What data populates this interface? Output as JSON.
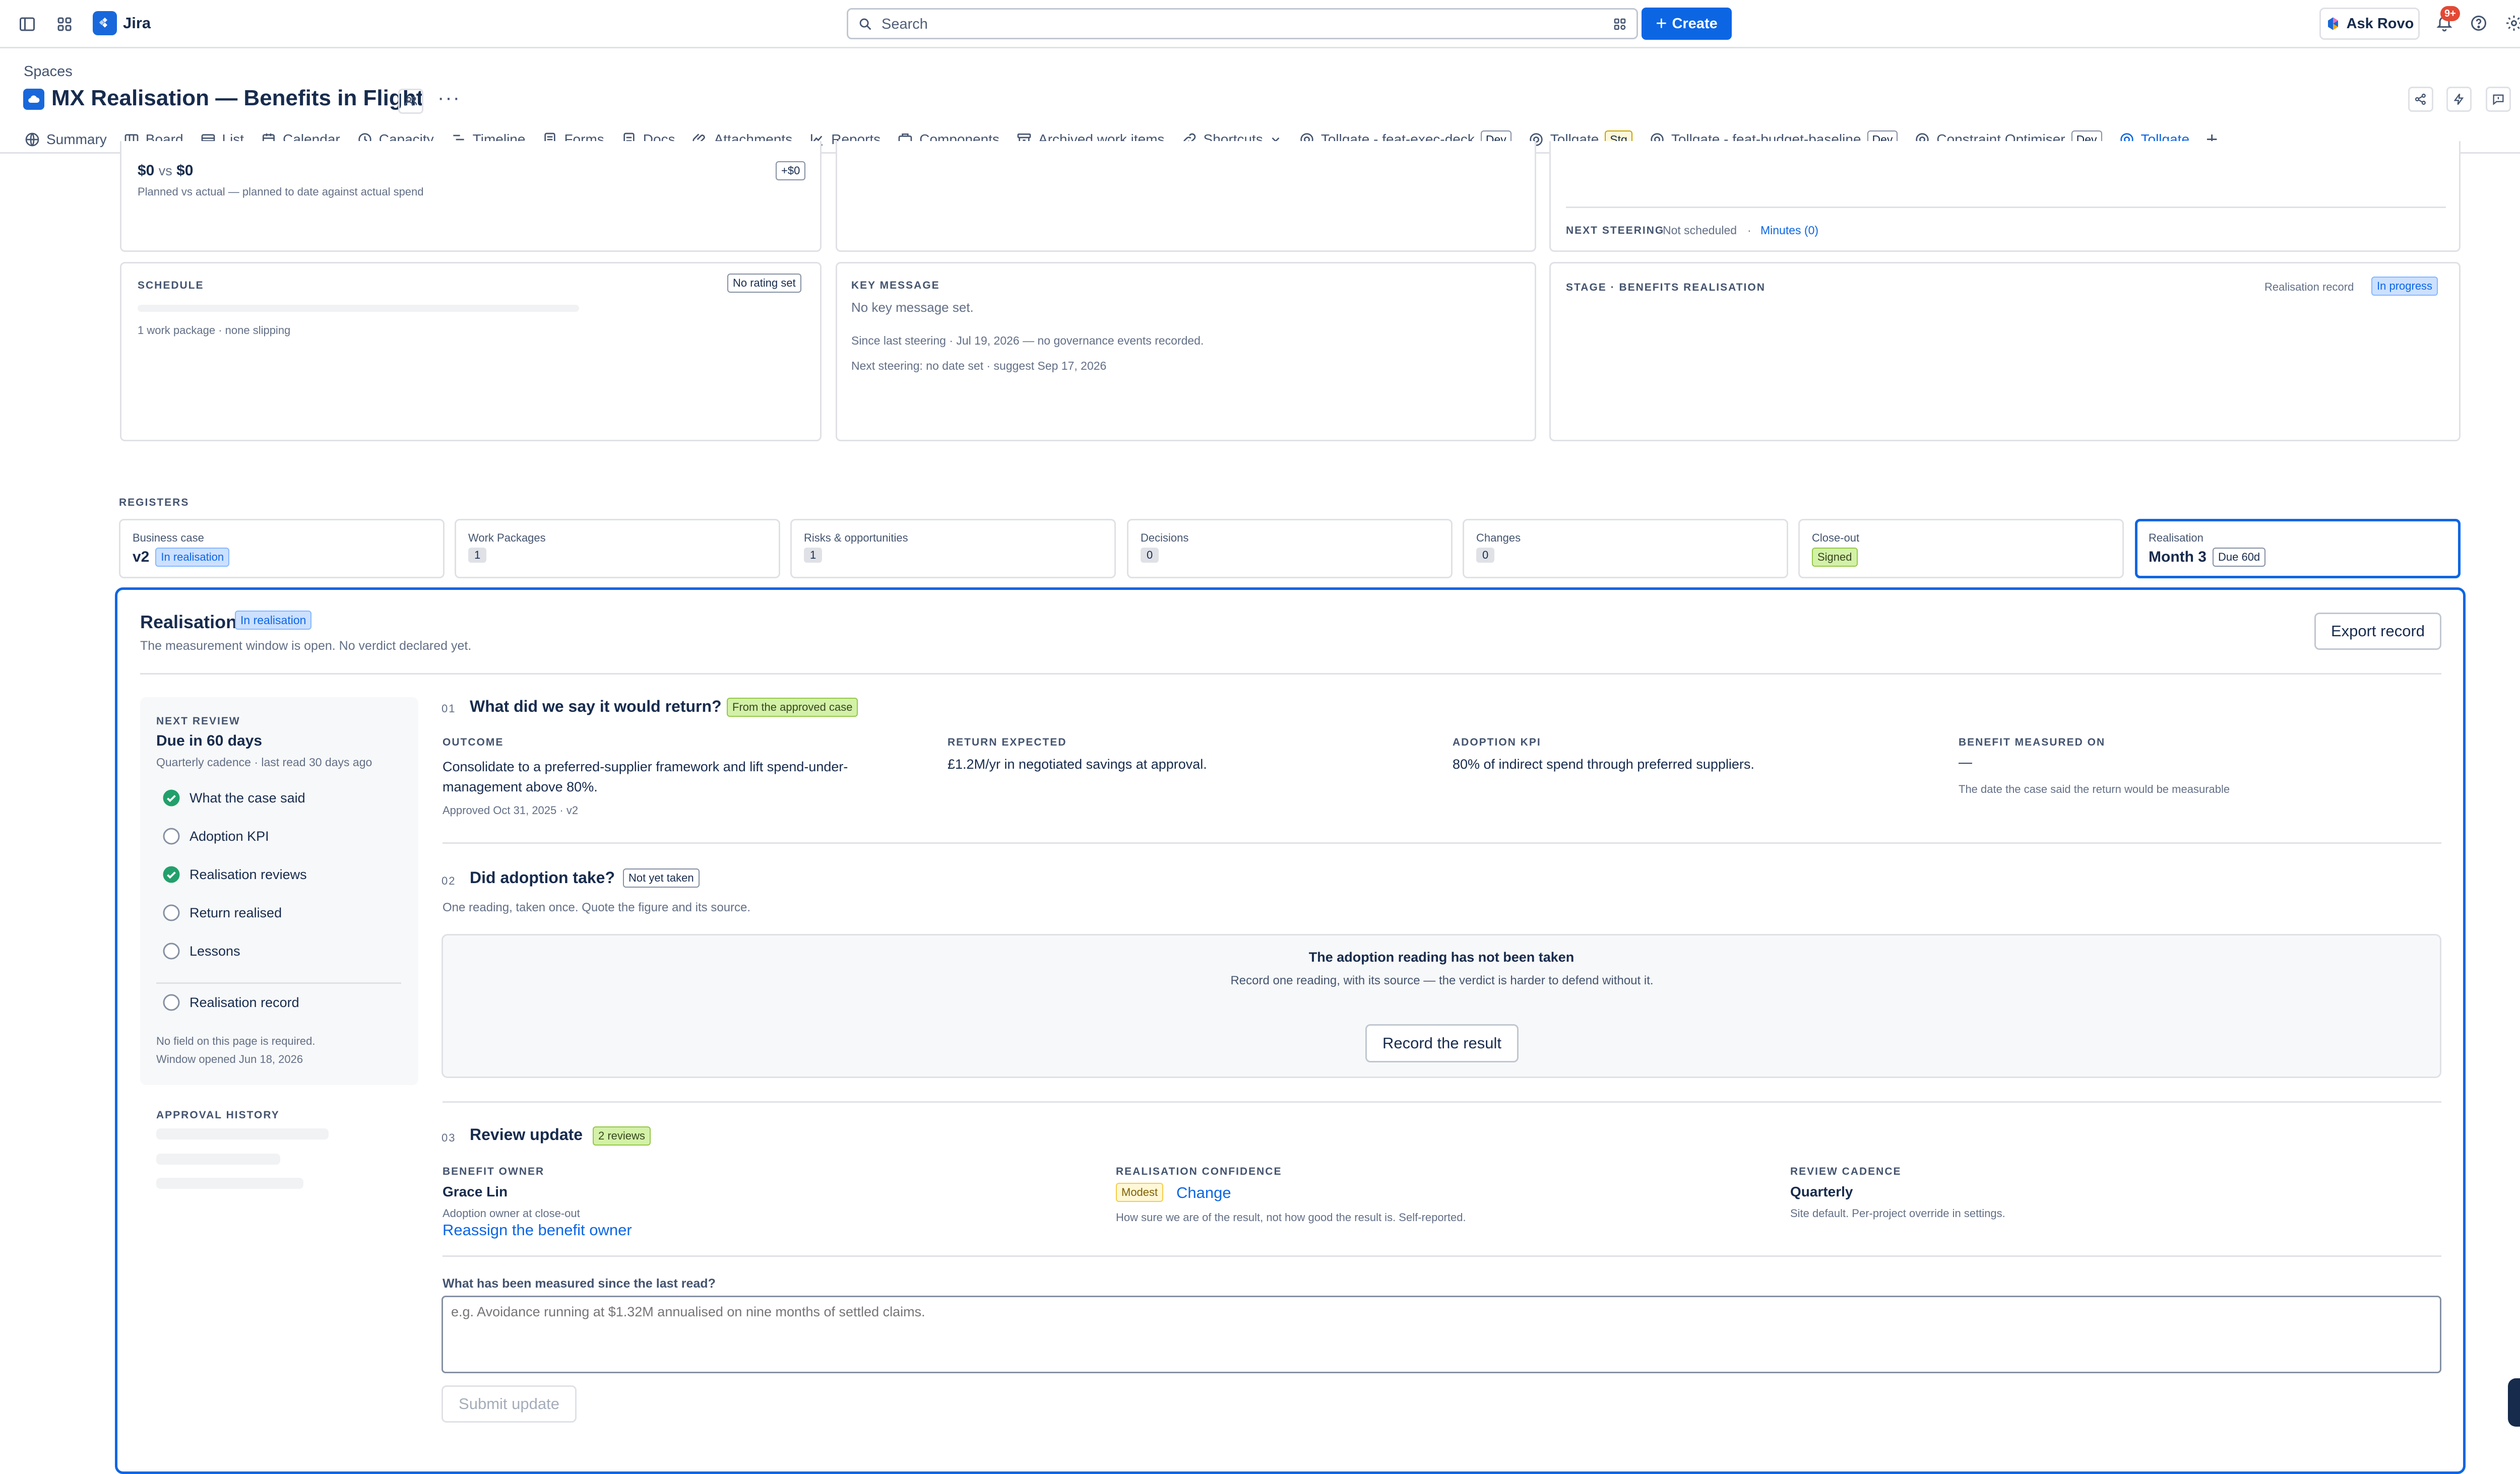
{
  "app": {
    "name": "Jira"
  },
  "topbar": {
    "search_placeholder": "Search",
    "create_label": "Create",
    "ask_rovo_label": "Ask Rovo",
    "notifications_count": "9+"
  },
  "header": {
    "breadcrumb": "Spaces",
    "title": "MX Realisation — Benefits in Flight"
  },
  "tabs": [
    {
      "label": "Summary",
      "icon": "globe-icon"
    },
    {
      "label": "Board",
      "icon": "board-icon"
    },
    {
      "label": "List",
      "icon": "list-icon"
    },
    {
      "label": "Calendar",
      "icon": "calendar-icon"
    },
    {
      "label": "Capacity",
      "icon": "capacity-icon"
    },
    {
      "label": "Timeline",
      "icon": "timeline-icon"
    },
    {
      "label": "Forms",
      "icon": "forms-icon"
    },
    {
      "label": "Docs",
      "icon": "docs-icon"
    },
    {
      "label": "Attachments",
      "icon": "attachment-icon"
    },
    {
      "label": "Reports",
      "icon": "reports-icon"
    },
    {
      "label": "Components",
      "icon": "components-icon"
    },
    {
      "label": "Archived work items",
      "icon": "archive-icon"
    },
    {
      "label": "Shortcuts",
      "icon": "link-icon"
    },
    {
      "label": "Tollgate - feat-exec-deck",
      "badge": "Dev",
      "icon": "tollgate-icon"
    },
    {
      "label": "Tollgate",
      "badge": "Stg",
      "icon": "tollgate-icon"
    },
    {
      "label": "Tollgate - feat-budget-baseline",
      "badge": "Dev",
      "icon": "tollgate-icon"
    },
    {
      "label": "Constraint Optimiser",
      "badge": "Dev",
      "icon": "tollgate-icon"
    },
    {
      "label": "Tollgate",
      "icon": "tollgate-icon",
      "active": true
    }
  ],
  "budget": {
    "planned": "$0",
    "vs": "vs",
    "actual": "$0",
    "delta": "+$0",
    "caption": "Planned vs actual — planned to date against actual spend"
  },
  "steering": {
    "label": "NEXT STEERING",
    "value": "Not scheduled",
    "sep": "·",
    "minutes": "Minutes (0)"
  },
  "schedule": {
    "label": "SCHEDULE",
    "rating": "No rating set",
    "caption": "1 work package · none slipping"
  },
  "key_message": {
    "label": "KEY MESSAGE",
    "value": "No key message set.",
    "line1": "Since last steering · Jul 19, 2026 — no governance events recorded.",
    "line2": "Next steering: no date set · suggest Sep 17, 2026"
  },
  "stage": {
    "label": "STAGE · BENEFITS REALISATION",
    "record_label": "Realisation record",
    "status": "In progress"
  },
  "registers": {
    "label": "REGISTERS",
    "items": [
      {
        "label": "Business case",
        "value": "v2",
        "chip": "In realisation"
      },
      {
        "label": "Work Packages",
        "chip": "1"
      },
      {
        "label": "Risks & opportunities",
        "chip": "1"
      },
      {
        "label": "Decisions",
        "chip": "0"
      },
      {
        "label": "Changes",
        "chip": "0"
      },
      {
        "label": "Close-out",
        "chip": "Signed"
      },
      {
        "label": "Realisation",
        "value": "Month 3",
        "chip": "Due 60d"
      }
    ]
  },
  "realisation": {
    "title": "Realisation",
    "status": "In realisation",
    "subtitle": "The measurement window is open. No verdict declared yet.",
    "export_label": "Export record",
    "sidebar": {
      "next_review_label": "NEXT REVIEW",
      "next_review_value": "Due in 60 days",
      "cadence": "Quarterly cadence · last read 30 days ago",
      "steps": [
        {
          "label": "What the case said",
          "done": true
        },
        {
          "label": "Adoption KPI",
          "done": false
        },
        {
          "label": "Realisation reviews",
          "done": true
        },
        {
          "label": "Return realised",
          "done": false
        },
        {
          "label": "Lessons",
          "done": false
        }
      ],
      "record_step": "Realisation record",
      "note1": "No field on this page is required.",
      "note2": "Window opened Jun 18, 2026",
      "approval_label": "APPROVAL HISTORY"
    },
    "s1": {
      "num": "01",
      "title": "What did we say it would return?",
      "chip": "From the approved case",
      "outcome_label": "OUTCOME",
      "outcome": "Consolidate to a preferred-supplier framework and lift spend-under-management above 80%.",
      "approved": "Approved Oct 31, 2025 · v2",
      "return_label": "RETURN EXPECTED",
      "return_value": "£1.2M/yr in negotiated savings at approval.",
      "kpi_label": "ADOPTION KPI",
      "kpi_value": "80% of indirect spend through preferred suppliers.",
      "measured_label": "BENEFIT MEASURED ON",
      "measured_value": "—",
      "measured_caption": "The date the case said the return would be measurable"
    },
    "s2": {
      "num": "02",
      "title": "Did adoption take?",
      "chip": "Not yet taken",
      "subtitle": "One reading, taken once. Quote the figure and its source.",
      "empty_title": "The adoption reading has not been taken",
      "empty_text": "Record one reading, with its source — the verdict is harder to defend without it.",
      "record_button": "Record the result"
    },
    "s3": {
      "num": "03",
      "title": "Review update",
      "chip": "2 reviews",
      "owner_label": "BENEFIT OWNER",
      "owner": "Grace Lin",
      "owner_caption": "Adoption owner at close-out",
      "reassign": "Reassign the benefit owner",
      "confidence_label": "REALISATION CONFIDENCE",
      "confidence": "Modest",
      "change": "Change",
      "confidence_caption": "How sure we are of the result, not how good the result is. Self-reported.",
      "cadence_label": "REVIEW CADENCE",
      "cadence": "Quarterly",
      "cadence_caption": "Site default. Per-project override in settings.",
      "measured_question": "What has been measured since the last read?",
      "measured_placeholder": "e.g. Avoidance running at $1.32M annualised on nine months of settled claims.",
      "submit": "Submit update"
    }
  },
  "colors": {
    "accent": "#0c66e4",
    "border": "#dfe1e6",
    "success": "#22a06b"
  }
}
